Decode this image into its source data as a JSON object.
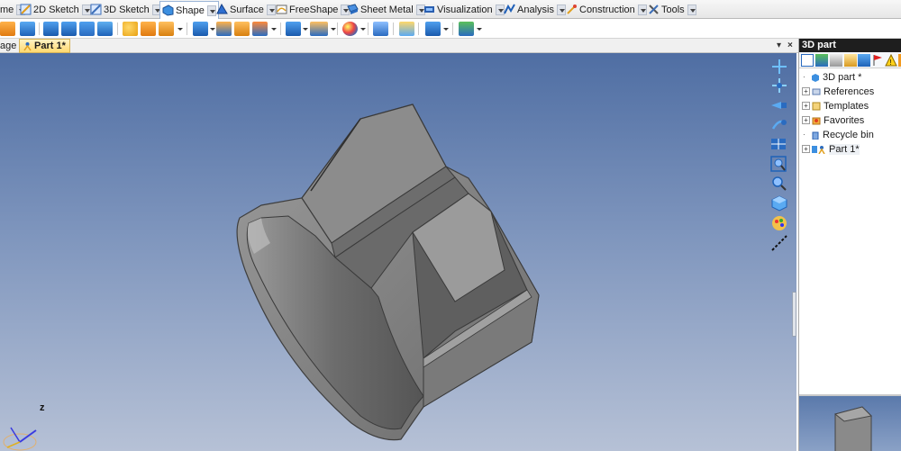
{
  "ribbon": {
    "tabs": [
      {
        "label": "me",
        "icon": "home-icon"
      },
      {
        "label": "2D Sketch",
        "icon": "sketch-2d-icon"
      },
      {
        "label": "3D Sketch",
        "icon": "sketch-3d-icon"
      },
      {
        "label": "Shape",
        "icon": "shape-icon"
      },
      {
        "label": "Surface",
        "icon": "surface-icon"
      },
      {
        "label": "FreeShape",
        "icon": "freeshape-icon"
      },
      {
        "label": "Sheet Metal",
        "icon": "sheet-metal-icon"
      },
      {
        "label": "Visualization",
        "icon": "visualization-icon"
      },
      {
        "label": "Analysis",
        "icon": "analysis-icon"
      },
      {
        "label": "Construction",
        "icon": "construction-icon"
      },
      {
        "label": "Tools",
        "icon": "tools-icon"
      }
    ],
    "active_tab": "Shape"
  },
  "document_tabs": [
    {
      "label": "age"
    },
    {
      "label": "Part 1*"
    }
  ],
  "panel": {
    "title": "3D part",
    "tree": [
      {
        "label": "3D part *",
        "icon": "part-root-icon"
      },
      {
        "label": "References",
        "icon": "references-icon"
      },
      {
        "label": "Templates",
        "icon": "templates-icon"
      },
      {
        "label": "Favorites",
        "icon": "favorites-icon"
      },
      {
        "label": "Recycle bin",
        "icon": "recycle-bin-icon"
      },
      {
        "label": "Part 1*",
        "icon": "part-icon"
      }
    ]
  },
  "triad": {
    "z_label": "z"
  },
  "colors": {
    "viewport_top": "#4f6ea3",
    "viewport_bottom": "#b6c1d6",
    "part_face": "#8a8a8a",
    "panel_title_bg": "#1e1e1e",
    "active_doc_tab": "#ffd970"
  }
}
